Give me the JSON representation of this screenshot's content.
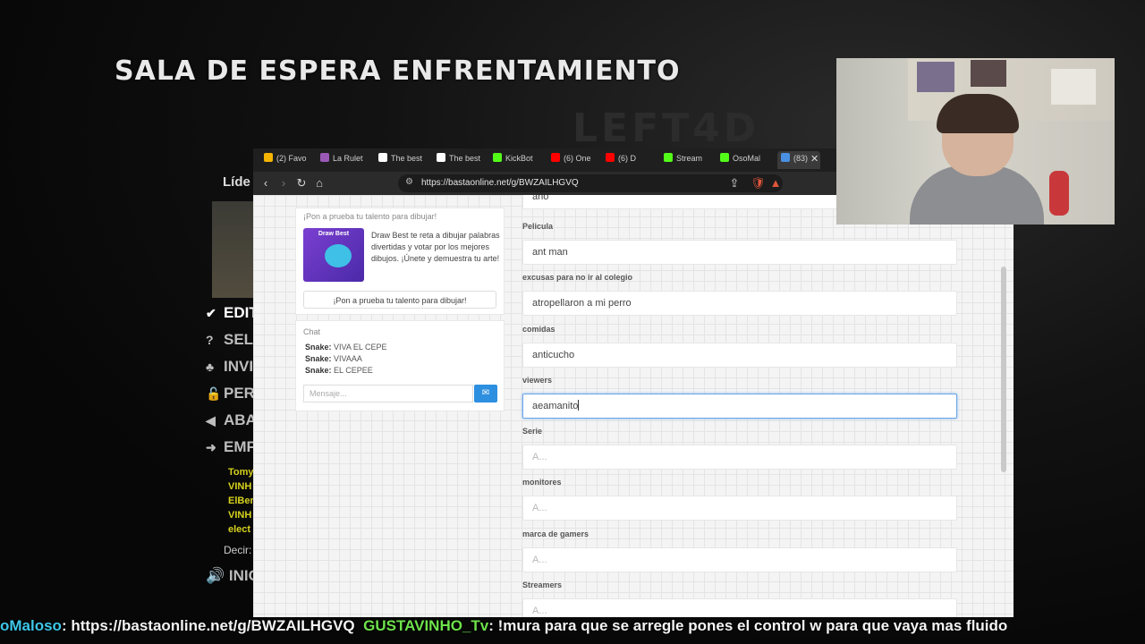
{
  "game": {
    "title": "SALA DE ESPERA ENFRENTAMIENTO",
    "leader_label": "Líde",
    "menu": [
      {
        "icon": "check-icon",
        "glyph": "✔",
        "label": "EDIT",
        "color": "#ffffff"
      },
      {
        "icon": "question-icon",
        "glyph": "?",
        "label": "SEL",
        "color": "#bdbdbd"
      },
      {
        "icon": "invite-icon",
        "glyph": "♣",
        "label": "INVI",
        "color": "#bdbdbd"
      },
      {
        "icon": "lock-icon",
        "glyph": "🔓",
        "label": "PER",
        "color": "#bdbdbd"
      },
      {
        "icon": "abandon-icon",
        "glyph": "◀",
        "label": "ABA",
        "color": "#bdbdbd"
      },
      {
        "icon": "arrow-right-icon",
        "glyph": "➜",
        "label": "EMP",
        "color": "#bdbdbd"
      }
    ],
    "players": [
      "Tomy",
      "VINH",
      "ElBer",
      "VINH",
      "elect"
    ],
    "say_label": "Decir:",
    "inicio_label": "INIC"
  },
  "browser": {
    "tabs": [
      {
        "label": "(2) Favo",
        "color": "#f4b400"
      },
      {
        "label": "La Rulet",
        "color": "#9b59b6"
      },
      {
        "label": "The best",
        "color": "#ffffff"
      },
      {
        "label": "The best",
        "color": "#ffffff"
      },
      {
        "label": "KickBot",
        "color": "#53fc18"
      },
      {
        "label": "(6) One",
        "color": "#ff0000"
      },
      {
        "label": "(6) D",
        "color": "#ff0000"
      },
      {
        "label": "Stream",
        "color": "#53fc18"
      },
      {
        "label": "OsoMal",
        "color": "#53fc18"
      },
      {
        "label": "(83)",
        "color": "#4a90e2"
      }
    ],
    "url": "https://bastaonline.net/g/BWZAILHGVQ"
  },
  "promo": {
    "heading": "¡Pon a prueba tu talento para dibujar!",
    "image_title": "Draw Best",
    "text": "Draw Best te reta a dibujar palabras divertidas y votar por los mejores dibujos. ¡Únete y demuestra tu arte!",
    "button": "¡Pon a prueba tu talento para dibujar!"
  },
  "chat": {
    "title": "Chat",
    "messages": [
      {
        "user": "Snake:",
        "text": "VIVA EL CEPE"
      },
      {
        "user": "Snake:",
        "text": "VIVAAA"
      },
      {
        "user": "Snake:",
        "text": "EL CEPEE"
      }
    ],
    "placeholder": "Mensaje..."
  },
  "form": {
    "fields": [
      {
        "label": "",
        "value": "año",
        "placeholder": ""
      },
      {
        "label": "Pelicula",
        "value": "ant man",
        "placeholder": ""
      },
      {
        "label": "excusas para no ir al colegio",
        "value": "atropellaron a mi perro",
        "placeholder": ""
      },
      {
        "label": "comidas",
        "value": "anticucho",
        "placeholder": ""
      },
      {
        "label": "viewers",
        "value": "aeamanito",
        "placeholder": ""
      },
      {
        "label": "Serie",
        "value": "",
        "placeholder": "A..."
      },
      {
        "label": "monitores",
        "value": "",
        "placeholder": "A..."
      },
      {
        "label": "marca de gamers",
        "value": "",
        "placeholder": "A..."
      },
      {
        "label": "Streamers",
        "value": "",
        "placeholder": "A..."
      }
    ]
  },
  "stream_chat": {
    "user1": "oMaloso",
    "message1": ": https://bastaonline.net/g/BWZAILHGVQ",
    "user2": "GUSTAVINHO_Tv",
    "message2": ": !mura para que se arregle pones el control w para que vaya mas fluido"
  }
}
